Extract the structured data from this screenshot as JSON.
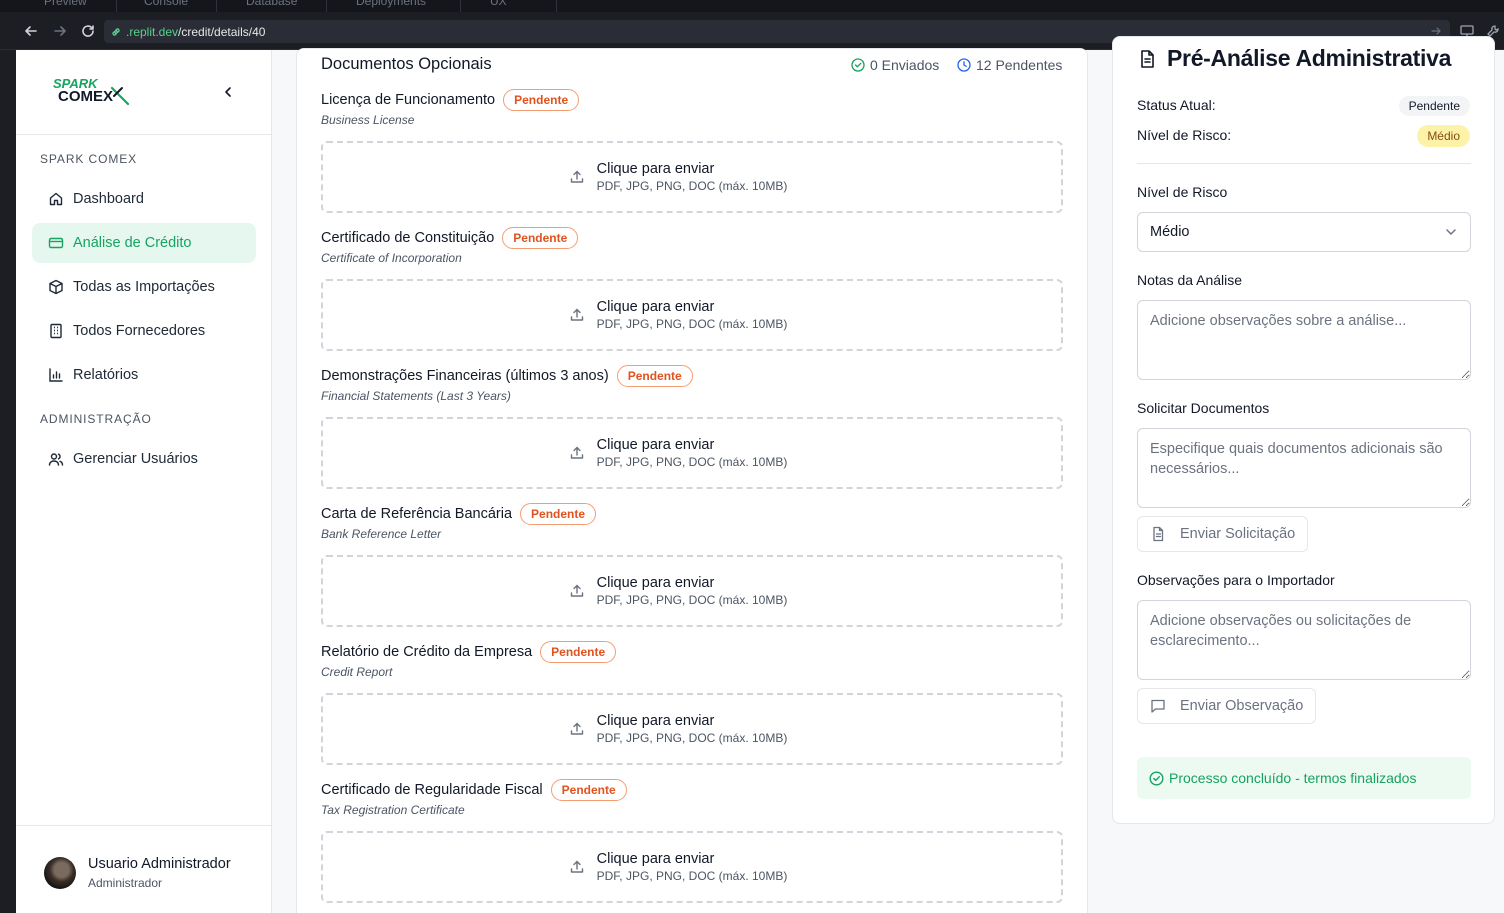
{
  "browser": {
    "tabs": [
      "Preview",
      "Console",
      "Database",
      "Deployments",
      "UX"
    ],
    "url_host": ".replit.dev",
    "url_path": "/credit/details/40"
  },
  "sidebar": {
    "logo_text_top": "SPARK",
    "logo_text_bottom": "COMEX",
    "section_main": "SPARK COMEX",
    "section_admin": "ADMINISTRAÇÃO",
    "items": [
      {
        "label": "Dashboard",
        "icon": "home-icon"
      },
      {
        "label": "Análise de Crédito",
        "icon": "credit-card-icon",
        "active": true
      },
      {
        "label": "Todas as Importações",
        "icon": "package-icon"
      },
      {
        "label": "Todos Fornecedores",
        "icon": "building-icon"
      },
      {
        "label": "Relatórios",
        "icon": "bar-chart-icon"
      }
    ],
    "admin_items": [
      {
        "label": "Gerenciar Usuários",
        "icon": "users-icon"
      }
    ],
    "user": {
      "name": "Usuario Administrador",
      "role": "Administrador"
    }
  },
  "documents": {
    "title": "Documentos Opcionais",
    "sent_label": "0 Enviados",
    "pending_label": "12 Pendentes",
    "upload_text": "Clique para enviar",
    "upload_hint": "PDF, JPG, PNG, DOC (máx. 10MB)",
    "status_label": "Pendente",
    "items": [
      {
        "name": "Licença de Funcionamento",
        "subtitle": "Business License"
      },
      {
        "name": "Certificado de Constituição",
        "subtitle": "Certificate of Incorporation"
      },
      {
        "name": "Demonstrações Financeiras (últimos 3 anos)",
        "subtitle": "Financial Statements (Last 3 Years)"
      },
      {
        "name": "Carta de Referência Bancária",
        "subtitle": "Bank Reference Letter"
      },
      {
        "name": "Relatório de Crédito da Empresa",
        "subtitle": "Credit Report"
      },
      {
        "name": "Certificado de Regularidade Fiscal",
        "subtitle": "Tax Registration Certificate"
      }
    ]
  },
  "panel": {
    "title": "Pré-Análise Administrativa",
    "status_label": "Status Atual:",
    "status_value": "Pendente",
    "risk_label": "Nível de Risco:",
    "risk_value": "Médio",
    "risk_select_label": "Nível de Risco",
    "risk_select_value": "Médio",
    "notes_label": "Notas da Análise",
    "notes_placeholder": "Adicione observações sobre a análise...",
    "request_label": "Solicitar Documentos",
    "request_placeholder": "Especifique quais documentos adicionais são necessários...",
    "request_button": "Enviar Solicitação",
    "obs_label": "Observações para o Importador",
    "obs_placeholder": "Adicione observações ou solicitações de esclarecimento...",
    "obs_button": "Enviar Observação",
    "success_text": "Processo concluído - termos finalizados"
  },
  "colors": {
    "accent_green": "#16a360",
    "pending_orange": "#e0531f",
    "risk_yellow": "#fdf3a8"
  }
}
